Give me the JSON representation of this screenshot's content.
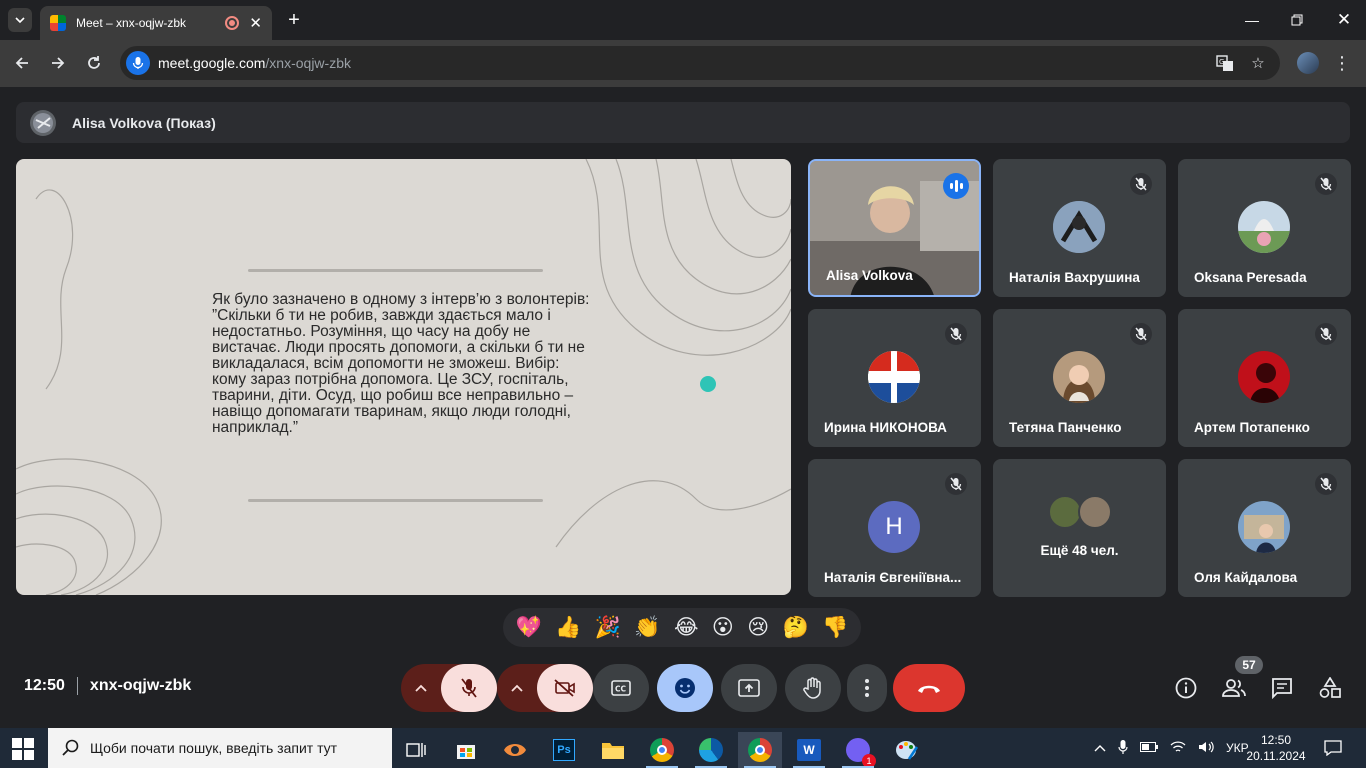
{
  "browser": {
    "tab_title": "Meet – xnx-oqjw-zbk",
    "url_host": "meet.google.com",
    "url_path": "/xnx-oqjw-zbk"
  },
  "meet": {
    "presenter_label": "Alisa Volkova (Показ)",
    "slide_quote": "Як було зазначено в одному з інтерв’ю з волонтерів:\n”Скільки б ти не робив, завжди здається мало і недостатньо. Розуміння, що часу на добу не вистачає. Люди просять допомоги, а скільки б ти не викладалася, всім допомогти не зможеш. Вибір: кому зараз потрібна допомога. Це ЗСУ, госпіталь, тварини, діти. Осуд, що робиш все неправильно – навіщо допомагати тваринам, якщо люди голодні, наприклад.”",
    "participants": [
      {
        "name": "Alisa Volkova"
      },
      {
        "name": "Наталія Вахрушина"
      },
      {
        "name": "Oksana Peresada"
      },
      {
        "name": "Ирина НИКОНОВА"
      },
      {
        "name": "Тетяна Панченко"
      },
      {
        "name": "Артем Потапенко"
      },
      {
        "name": "Наталія Євгеніївна..."
      },
      {
        "name": "Ещё 48 чел."
      },
      {
        "name": "Оля Кайдалова"
      }
    ],
    "initial_avatar": "Н",
    "reactions": [
      "💖",
      "👍",
      "🎉",
      "👏",
      "😂",
      "😮",
      "😢",
      "🤔",
      "👎"
    ],
    "time": "12:50",
    "meeting_code": "xnx-oqjw-zbk",
    "people_count": "57",
    "colors": {
      "end_call": "#dc362e",
      "accent": "#a8c7fa",
      "muted_bg": "#f9dedc"
    }
  },
  "taskbar": {
    "search_placeholder": "Щоби почати пошук, введіть запит тут",
    "language": "УКР",
    "clock_time": "12:50",
    "clock_date": "20.11.2024",
    "viber_badge": "1"
  }
}
